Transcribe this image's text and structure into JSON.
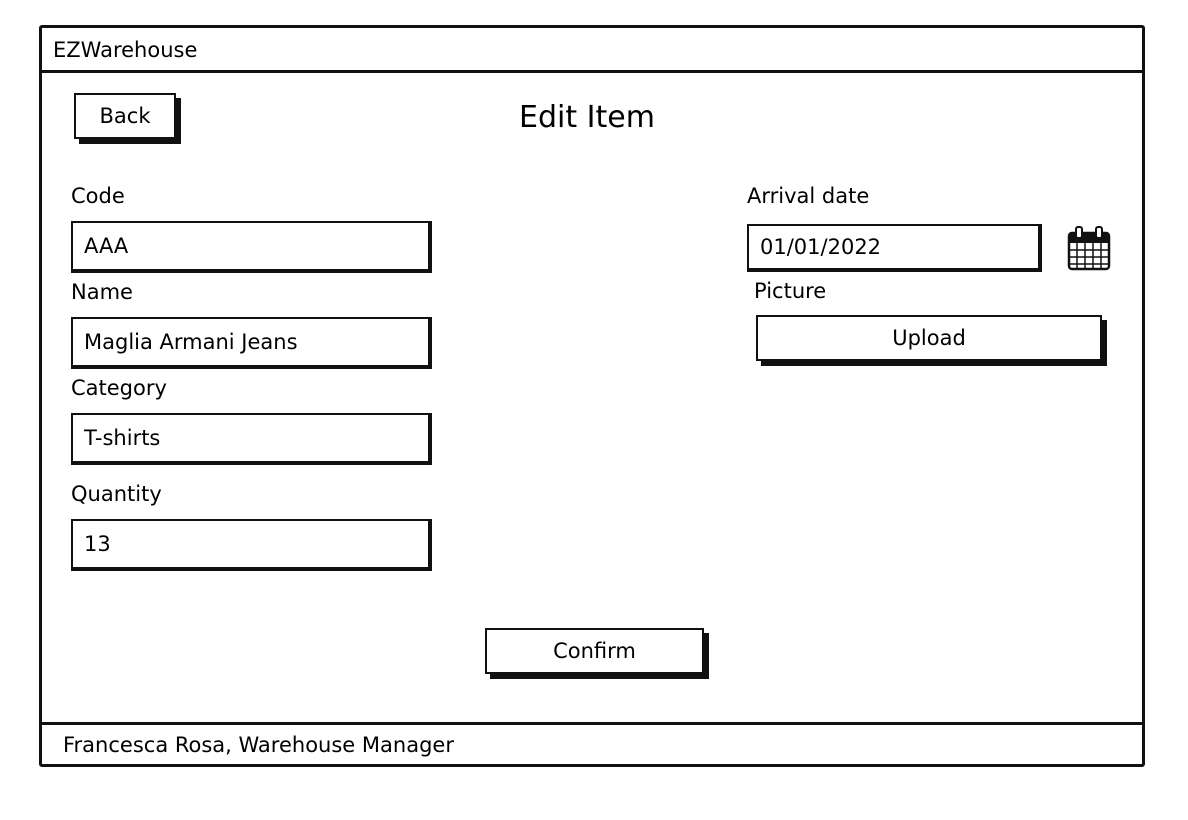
{
  "app": {
    "title": "EZWarehouse"
  },
  "header": {
    "back_label": "Back",
    "page_title": "Edit Item"
  },
  "form": {
    "code": {
      "label": "Code",
      "value": "AAA"
    },
    "name": {
      "label": "Name",
      "value": "Maglia Armani Jeans"
    },
    "category": {
      "label": "Category",
      "value": "T-shirts"
    },
    "quantity": {
      "label": "Quantity",
      "value": "13"
    },
    "arrival_date": {
      "label": "Arrival date",
      "value": "01/01/2022",
      "icon": "calendar-icon"
    },
    "picture": {
      "label": "Picture",
      "upload_label": "Upload"
    },
    "confirm_label": "Confirm"
  },
  "status": {
    "user": "Francesca Rosa, Warehouse Manager"
  }
}
